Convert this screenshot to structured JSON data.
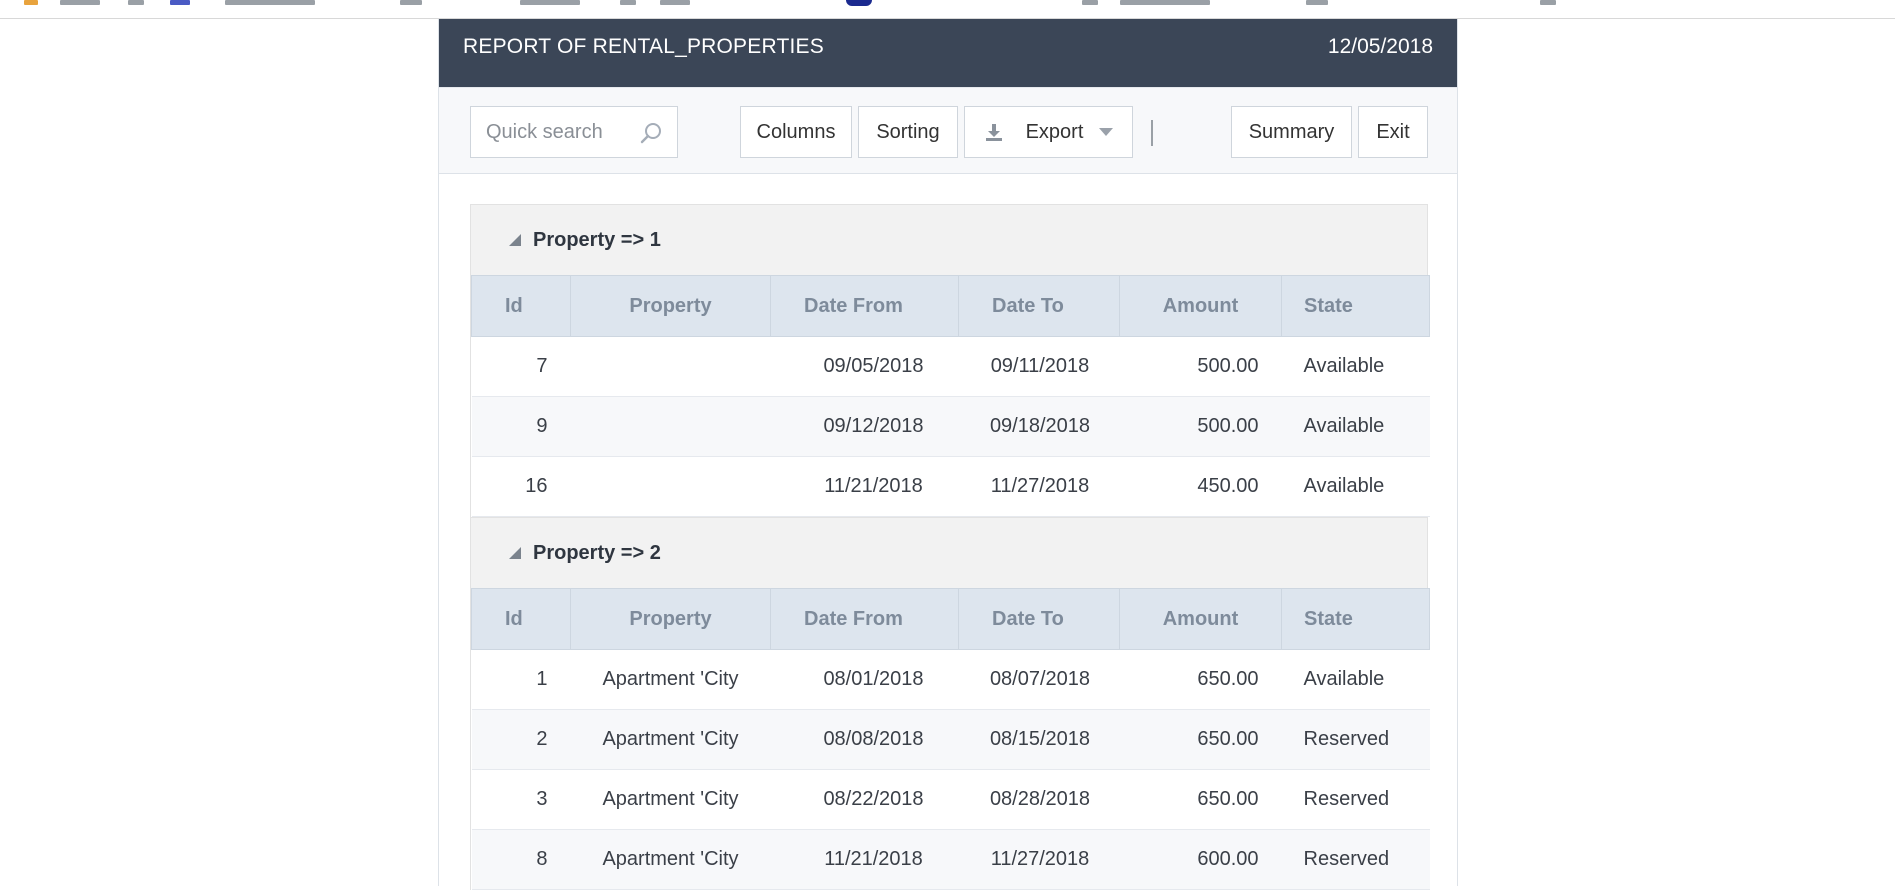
{
  "report": {
    "title": "REPORT OF RENTAL_PROPERTIES",
    "date": "12/05/2018"
  },
  "toolbar": {
    "search_placeholder": "Quick search",
    "columns_label": "Columns",
    "sorting_label": "Sorting",
    "export_label": "Export",
    "summary_label": "Summary",
    "exit_label": "Exit"
  },
  "columns": {
    "id": "Id",
    "property": "Property",
    "date_from": "Date From",
    "date_to": "Date To",
    "amount": "Amount",
    "state": "State"
  },
  "groups": [
    {
      "label": "Property => 1",
      "rows": [
        {
          "id": "7",
          "property": "",
          "date_from": "09/05/2018",
          "date_to": "09/11/2018",
          "amount": "500.00",
          "state": "Available"
        },
        {
          "id": "9",
          "property": "",
          "date_from": "09/12/2018",
          "date_to": "09/18/2018",
          "amount": "500.00",
          "state": "Available"
        },
        {
          "id": "16",
          "property": "",
          "date_from": "11/21/2018",
          "date_to": "11/27/2018",
          "amount": "450.00",
          "state": "Available"
        }
      ]
    },
    {
      "label": "Property => 2",
      "rows": [
        {
          "id": "1",
          "property": "Apartment 'City",
          "date_from": "08/01/2018",
          "date_to": "08/07/2018",
          "amount": "650.00",
          "state": "Available"
        },
        {
          "id": "2",
          "property": "Apartment 'City",
          "date_from": "08/08/2018",
          "date_to": "08/15/2018",
          "amount": "650.00",
          "state": "Reserved"
        },
        {
          "id": "3",
          "property": "Apartment 'City",
          "date_from": "08/22/2018",
          "date_to": "08/28/2018",
          "amount": "650.00",
          "state": "Reserved"
        },
        {
          "id": "8",
          "property": "Apartment 'City",
          "date_from": "11/21/2018",
          "date_to": "11/27/2018",
          "amount": "600.00",
          "state": "Reserved"
        }
      ]
    }
  ],
  "colors": {
    "titlebar": "#3b4657",
    "header_row": "#dde5ee",
    "group_row": "#f2f2f2"
  }
}
